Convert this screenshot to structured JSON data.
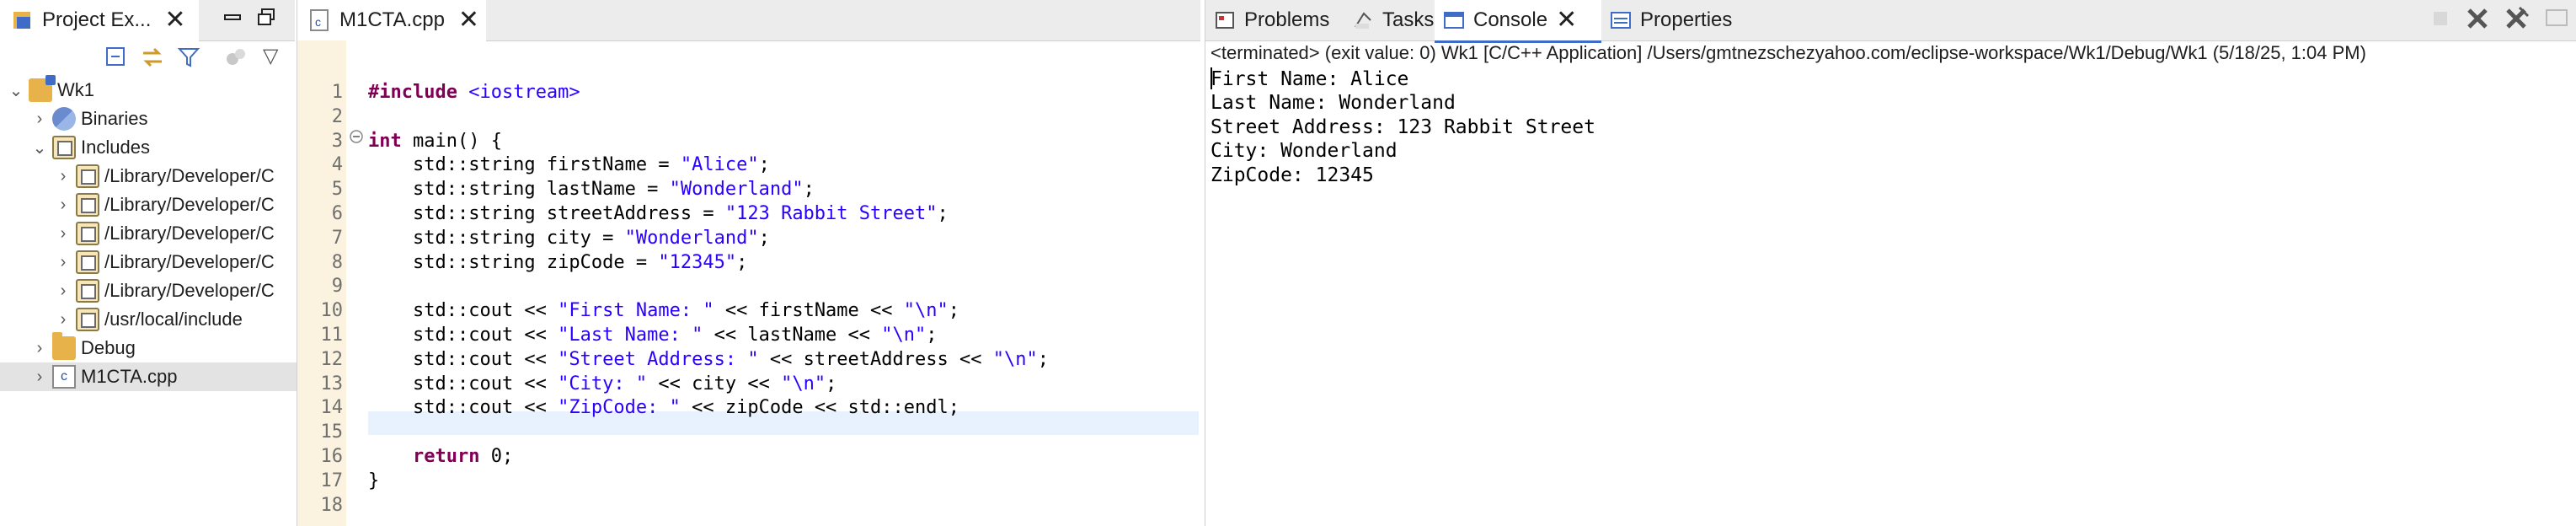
{
  "explorer": {
    "tab_label": "Project Ex...",
    "tree": [
      {
        "label": "Wk1",
        "icon": "project-icon",
        "twisty": "⌄",
        "indent": 0
      },
      {
        "label": "Binaries",
        "icon": "binaries-icon",
        "twisty": "›",
        "indent": 1
      },
      {
        "label": "Includes",
        "icon": "includes-icon",
        "twisty": "⌄",
        "indent": 1
      },
      {
        "label": "/Library/Developer/C",
        "icon": "include-folder-icon",
        "twisty": "›",
        "indent": 2
      },
      {
        "label": "/Library/Developer/C",
        "icon": "include-folder-icon",
        "twisty": "›",
        "indent": 2
      },
      {
        "label": "/Library/Developer/C",
        "icon": "include-folder-icon",
        "twisty": "›",
        "indent": 2
      },
      {
        "label": "/Library/Developer/C",
        "icon": "include-folder-icon",
        "twisty": "›",
        "indent": 2
      },
      {
        "label": "/Library/Developer/C",
        "icon": "include-folder-icon",
        "twisty": "›",
        "indent": 2
      },
      {
        "label": "/usr/local/include",
        "icon": "include-folder-icon",
        "twisty": "›",
        "indent": 2
      },
      {
        "label": "Debug",
        "icon": "folder-icon",
        "twisty": "›",
        "indent": 1
      },
      {
        "label": "M1CTA.cpp",
        "icon": "cpp-file-icon",
        "twisty": "›",
        "indent": 1,
        "selected": true
      }
    ]
  },
  "editor": {
    "tab_label": "M1CTA.cpp",
    "lines": [
      {
        "n": "1",
        "code": "#include <iostream>"
      },
      {
        "n": "2",
        "code": ""
      },
      {
        "n": "3",
        "code": "int main() {"
      },
      {
        "n": "4",
        "code": "    std::string firstName = \"Alice\";"
      },
      {
        "n": "5",
        "code": "    std::string lastName = \"Wonderland\";"
      },
      {
        "n": "6",
        "code": "    std::string streetAddress = \"123 Rabbit Street\";"
      },
      {
        "n": "7",
        "code": "    std::string city = \"Wonderland\";"
      },
      {
        "n": "8",
        "code": "    std::string zipCode = \"12345\";"
      },
      {
        "n": "9",
        "code": ""
      },
      {
        "n": "10",
        "code": "    std::cout << \"First Name: \" << firstName << \"\\n\";"
      },
      {
        "n": "11",
        "code": "    std::cout << \"Last Name: \" << lastName << \"\\n\";"
      },
      {
        "n": "12",
        "code": "    std::cout << \"Street Address: \" << streetAddress << \"\\n\";"
      },
      {
        "n": "13",
        "code": "    std::cout << \"City: \" << city << \"\\n\";"
      },
      {
        "n": "14",
        "code": "    std::cout << \"ZipCode: \" << zipCode << std::endl;"
      },
      {
        "n": "15",
        "code": ""
      },
      {
        "n": "16",
        "code": "    return 0;"
      },
      {
        "n": "17",
        "code": "}"
      },
      {
        "n": "18",
        "code": ""
      }
    ]
  },
  "console": {
    "tabs": [
      {
        "label": "Problems",
        "icon": "problems-icon"
      },
      {
        "label": "Tasks",
        "icon": "tasks-icon"
      },
      {
        "label": "Console",
        "icon": "console-icon",
        "active": true
      },
      {
        "label": "Properties",
        "icon": "properties-icon"
      }
    ],
    "status": "<terminated> (exit value: 0) Wk1 [C/C++ Application] /Users/gmtnezschezyahoo.com/eclipse-workspace/Wk1/Debug/Wk1 (5/18/25, 1:04 PM)",
    "output": [
      "First Name: Alice",
      "Last Name: Wonderland",
      "Street Address: 123 Rabbit Street",
      "City: Wonderland",
      "ZipCode: 12345"
    ]
  },
  "colors": {
    "keyword": "#7f0055",
    "string": "#2a00ff",
    "gutter": "#fbf3df",
    "current_line": "#e8f2fe",
    "selection": "#e3e3e3",
    "tab_active_underline": "#3f6cc6"
  }
}
